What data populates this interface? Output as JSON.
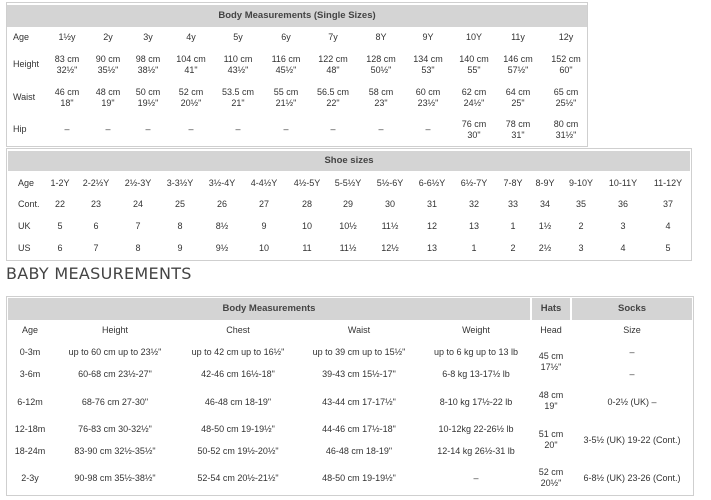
{
  "single": {
    "title": "Body Measurements (Single Sizes)",
    "labels": [
      "Age",
      "Height",
      "Waist",
      "Hip"
    ],
    "ages": [
      "1½y",
      "2y",
      "3y",
      "4y",
      "5y",
      "6y",
      "7y",
      "8Y",
      "9Y",
      "10Y",
      "11y",
      "12y"
    ],
    "height": [
      [
        "83 cm",
        "32½\""
      ],
      [
        "90 cm",
        "35½\""
      ],
      [
        "98 cm",
        "38½\""
      ],
      [
        "104 cm",
        "41\""
      ],
      [
        "110 cm",
        "43½\""
      ],
      [
        "116 cm",
        "45½\""
      ],
      [
        "122 cm",
        "48\""
      ],
      [
        "128 cm",
        "50½\""
      ],
      [
        "134 cm",
        "53\""
      ],
      [
        "140 cm",
        "55\""
      ],
      [
        "146 cm",
        "57½\""
      ],
      [
        "152 cm",
        "60\""
      ]
    ],
    "waist": [
      [
        "46 cm",
        "18\""
      ],
      [
        "48 cm",
        "19\""
      ],
      [
        "50 cm",
        "19½\""
      ],
      [
        "52 cm",
        "20½\""
      ],
      [
        "53.5 cm",
        "21\""
      ],
      [
        "55 cm",
        "21½\""
      ],
      [
        "56.5 cm",
        "22\""
      ],
      [
        "58 cm",
        "23\""
      ],
      [
        "60 cm",
        "23½\""
      ],
      [
        "62 cm",
        "24½\""
      ],
      [
        "64 cm",
        "25\""
      ],
      [
        "65 cm",
        "25½\""
      ]
    ],
    "hip": [
      [
        "–"
      ],
      [
        "–"
      ],
      [
        "–"
      ],
      [
        "–"
      ],
      [
        "–"
      ],
      [
        "–"
      ],
      [
        "–"
      ],
      [
        "–"
      ],
      [
        "–"
      ],
      [
        "76 cm",
        "30\""
      ],
      [
        "78 cm",
        "31\""
      ],
      [
        "80 cm",
        "31½\""
      ]
    ]
  },
  "shoes": {
    "title": "Shoe sizes",
    "labels": [
      "Age",
      "Cont.",
      "UK",
      "US"
    ],
    "ages": [
      "1-2Y",
      "2-2½Y",
      "2½-3Y",
      "3-3½Y",
      "3½-4Y",
      "4-4½Y",
      "4½-5Y",
      "5-5½Y",
      "5½-6Y",
      "6-6½Y",
      "6½-7Y",
      "7-8Y",
      "8-9Y",
      "9-10Y",
      "10-11Y",
      "11-12Y"
    ],
    "cont": [
      "22",
      "23",
      "24",
      "25",
      "26",
      "27",
      "28",
      "29",
      "30",
      "31",
      "32",
      "33",
      "34",
      "35",
      "36",
      "37"
    ],
    "uk": [
      "5",
      "6",
      "7",
      "8",
      "8½",
      "9",
      "10",
      "10½",
      "11½",
      "12",
      "13",
      "1",
      "1½",
      "2",
      "3",
      "4"
    ],
    "us": [
      "6",
      "7",
      "8",
      "9",
      "9½",
      "10",
      "11",
      "11½",
      "12½",
      "13",
      "1",
      "2",
      "2½",
      "3",
      "4",
      "5"
    ]
  },
  "baby": {
    "section_title": "BABY MEASUREMENTS",
    "group_body": "Body Measurements",
    "group_hats": "Hats",
    "group_socks": "Socks",
    "columns": [
      "Age",
      "Height",
      "Chest",
      "Waist",
      "Weight",
      "Head",
      "Size"
    ],
    "rows": [
      {
        "age": "0-3m",
        "height": "up to 60 cm up to 23½\"",
        "chest": "up to 42 cm up to 16½\"",
        "waist": "up to 39 cm up to 15½\"",
        "weight": "up to 6 kg up to 13 lb"
      },
      {
        "age": "3-6m",
        "height": "60-68 cm 23½-27\"",
        "chest": "42-46 cm 16½-18\"",
        "waist": "39-43 cm 15½-17\"",
        "weight": "6-8 kg 13-17½ lb"
      },
      {
        "age": "6-12m",
        "height": "68-76 cm 27-30\"",
        "chest": "46-48 cm 18-19\"",
        "waist": "43-44 cm 17-17½\"",
        "weight": "8-10 kg 17½-22 lb"
      },
      {
        "age": "12-18m",
        "height": "76-83 cm 30-32½\"",
        "chest": "48-50 cm 19-19½\"",
        "waist": "44-46 cm 17½-18\"",
        "weight": "10-12kg 22-26½ lb"
      },
      {
        "age": "18-24m",
        "height": "83-90 cm 32½-35½\"",
        "chest": "50-52 cm 19½-20½\"",
        "waist": "46-48 cm 18-19\"",
        "weight": "12-14 kg 26½-31 lb"
      },
      {
        "age": "2-3y",
        "height": "90-98 cm 35½-38½\"",
        "chest": "52-54 cm 20½-21½\"",
        "waist": "48-50 cm 19-19½\"",
        "weight": "–"
      }
    ],
    "head": [
      [
        "45 cm",
        "17½\""
      ],
      [
        "48 cm",
        "19\""
      ],
      [
        "51 cm",
        "20\""
      ],
      [
        "52 cm",
        "20½\""
      ]
    ],
    "socks": [
      "–",
      "–",
      "0-2½ (UK) –",
      "3-5½ (UK) 19-22 (Cont.)",
      "6-8½ (UK) 23-26 (Cont.)"
    ]
  }
}
